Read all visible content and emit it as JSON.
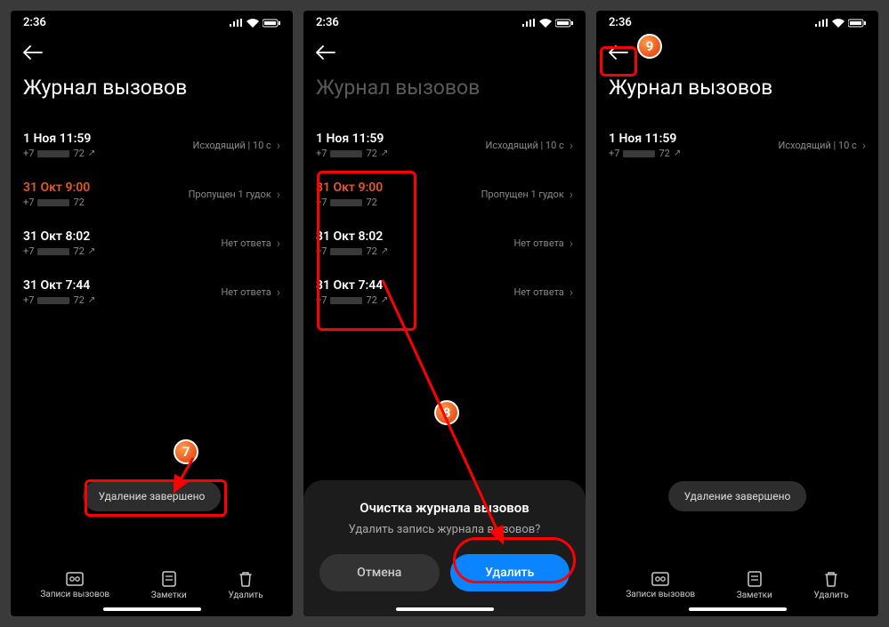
{
  "status": {
    "time": "2:36",
    "signal": "..ıl",
    "wifi": "⩚",
    "battery": "▢"
  },
  "title": "Журнал вызовов",
  "calls_full": [
    {
      "dt": "1 Ноя 11:59",
      "num_pre": "+7",
      "num_suf": "72",
      "status": "Исходящий | 10 с",
      "missed": false,
      "out": true
    },
    {
      "dt": "31 Окт 9:00",
      "num_pre": "+7",
      "num_suf": "72",
      "status": "Пропущен 1 гудок",
      "missed": true,
      "out": false
    },
    {
      "dt": "31 Окт 8:02",
      "num_pre": "+7",
      "num_suf": "72",
      "status": "Нет ответа",
      "missed": false,
      "out": true
    },
    {
      "dt": "31 Окт 7:44",
      "num_pre": "+7",
      "num_suf": "72",
      "status": "Нет ответа",
      "missed": false,
      "out": true
    }
  ],
  "calls_short": [
    {
      "dt": "1 Ноя 11:59",
      "num_pre": "+7",
      "num_suf": "72",
      "status": "Исходящий | 10 с",
      "missed": false,
      "out": true
    }
  ],
  "toast": "Удаление завершено",
  "bottom": {
    "recordings": "Записи вызовов",
    "notes": "Заметки",
    "delete": "Удалить"
  },
  "dialog": {
    "title": "Очистка журнала вызовов",
    "subtitle": "Удалить запись журнала вызовов?",
    "cancel": "Отмена",
    "delete": "Удалить"
  },
  "badges": {
    "b7": "7",
    "b8": "8",
    "b9": "9"
  }
}
